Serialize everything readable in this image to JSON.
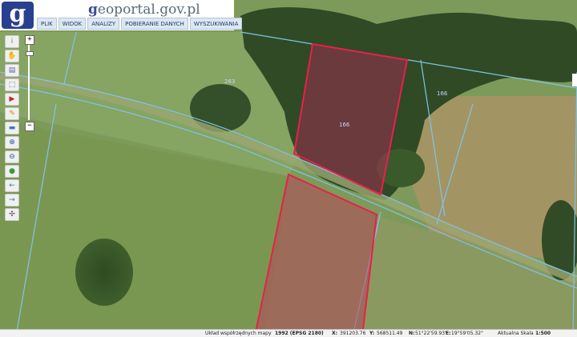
{
  "header": {
    "logo_letter": "g",
    "brand_prefix": "g",
    "brand_main": "eoportal",
    "brand_suffix": ".gov.pl"
  },
  "menu": [
    {
      "label": "PLIK"
    },
    {
      "label": "WIDOK"
    },
    {
      "label": "ANALIZY"
    },
    {
      "label": "POBIERANIE DANYCH"
    },
    {
      "label": "WYSZUKIWANIA"
    }
  ],
  "toolbar": [
    {
      "name": "info-icon",
      "glyph": "i",
      "color": "#3aa63a"
    },
    {
      "name": "hand-icon",
      "glyph": "✋",
      "color": "#c08030"
    },
    {
      "name": "legend-icon",
      "glyph": "▤",
      "color": "#5566aa"
    },
    {
      "name": "select-icon",
      "glyph": "⬚",
      "color": "#2255aa"
    },
    {
      "name": "truck-icon",
      "glyph": "▶",
      "color": "#cc2222"
    },
    {
      "name": "pencil-icon",
      "glyph": "✎",
      "color": "#cc8800"
    },
    {
      "name": "ruler-icon",
      "glyph": "▬",
      "color": "#3377cc"
    },
    {
      "name": "zoom-in-icon",
      "glyph": "⊕",
      "color": "#2255aa"
    },
    {
      "name": "zoom-out-icon",
      "glyph": "⊖",
      "color": "#2255aa"
    },
    {
      "name": "globe-icon",
      "glyph": "●",
      "color": "#3a9a3a"
    },
    {
      "name": "back-arrow-icon",
      "glyph": "←",
      "color": "#2277cc"
    },
    {
      "name": "forward-arrow-icon",
      "glyph": "→",
      "color": "#2277cc"
    },
    {
      "name": "compass-icon",
      "glyph": "✣",
      "color": "#555555"
    }
  ],
  "zoom": {
    "plus": "+",
    "minus": "−"
  },
  "map": {
    "parcel_labels": [
      "263",
      "166",
      "166"
    ]
  },
  "status": {
    "system_label": "Układ współrzędnych mapy",
    "system_value": "1992 (EPSG 2180)",
    "x_label": "X:",
    "x_value": "391203.76",
    "y_label": "Y:",
    "y_value": "568511.49",
    "n_label": "N:",
    "n_value": "51°22'59.93\"",
    "e_label": "E:",
    "e_value": "19°59'05.32\"",
    "scale_label": "Aktualna Skala",
    "scale_value": "1:500"
  },
  "colors": {
    "parcel_outline": "#e8204a",
    "parcel_fill": "rgba(180,40,90,0.45)",
    "boundary_line": "#7fc4e8",
    "header_blue": "#2b3f8f"
  }
}
